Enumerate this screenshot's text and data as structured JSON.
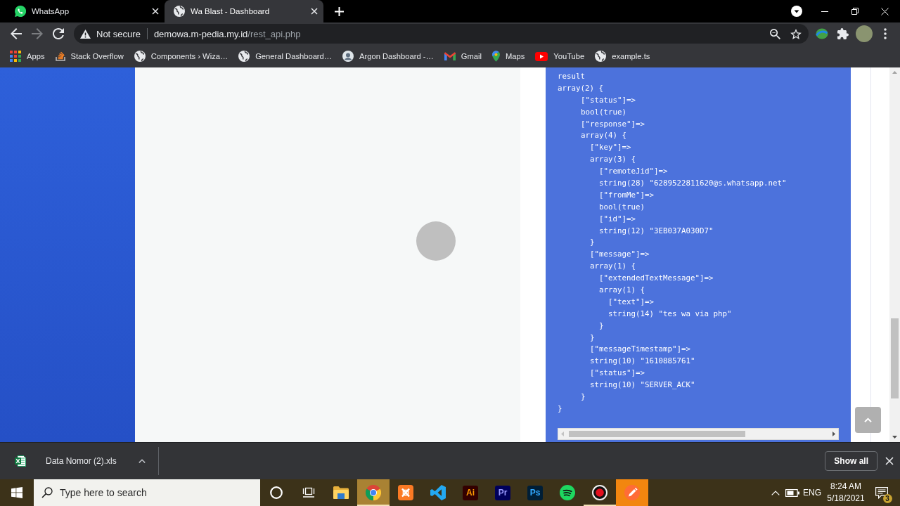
{
  "browser": {
    "tabs": [
      {
        "title": "WhatsApp",
        "kind": "chat",
        "selected": false
      },
      {
        "title": "Wa Blast - Dashboard",
        "kind": "globe",
        "selected": true
      }
    ],
    "toolbar": {
      "buttons": [
        {
          "kind": "back",
          "disabled": false
        },
        {
          "kind": "forward",
          "disabled": true
        },
        {
          "kind": "reload",
          "disabled": false
        }
      ],
      "security": "Not secure",
      "url": {
        "host": "demowa.m-pedia.my.id",
        "path": "/rest_api.php"
      }
    },
    "bookmarks": [
      {
        "label": "Apps",
        "kind": "apps"
      },
      {
        "label": "Stack Overflow",
        "kind": "stack"
      },
      {
        "label": "Components › Wiza…",
        "kind": "globe"
      },
      {
        "label": "General Dashboard…",
        "kind": "globe"
      },
      {
        "label": "Argon Dashboard -…",
        "kind": "avatar"
      },
      {
        "label": "Gmail",
        "kind": "mail"
      },
      {
        "label": "Maps",
        "kind": "pin"
      },
      {
        "label": "YouTube",
        "kind": "video"
      },
      {
        "label": "example.ts",
        "kind": "globe"
      }
    ]
  },
  "page": {
    "code": {
      "lines": [
        {
          "text": "result"
        },
        {
          "text": "array(2) {",
          "close": "}",
          "children": [
            {
              "text": "[\"status\"]=>"
            },
            {
              "text": "bool(true)"
            },
            {
              "text": "[\"response\"]=>"
            },
            {
              "text": "array(4) {",
              "close": "}",
              "children": [
                {
                  "text": "[\"key\"]=>"
                },
                {
                  "text": "array(3) {",
                  "close": "}",
                  "children": [
                    {
                      "text": "[\"remoteJid\"]=>"
                    },
                    {
                      "text": "string(28) \"6289522811620@s.whatsapp.net\""
                    },
                    {
                      "text": "[\"fromMe\"]=>"
                    },
                    {
                      "text": "bool(true)"
                    },
                    {
                      "text": "[\"id\"]=>"
                    },
                    {
                      "text": "string(12) \"3EB037A030D7\""
                    }
                  ]
                },
                {
                  "text": "[\"message\"]=>"
                },
                {
                  "text": "array(1) {",
                  "close": "}",
                  "children": [
                    {
                      "text": "[\"extendedTextMessage\"]=>"
                    },
                    {
                      "text": "array(1) {",
                      "close": "}",
                      "children": [
                        {
                          "text": "[\"text\"]=>"
                        },
                        {
                          "text": "string(14) \"tes wa via php\""
                        }
                      ]
                    }
                  ]
                },
                {
                  "text": "[\"messageTimestamp\"]=>"
                },
                {
                  "text": "string(10) \"1610885761\""
                },
                {
                  "text": "[\"status\"]=>"
                },
                {
                  "text": "string(10) \"SERVER_ACK\""
                }
              ]
            }
          ]
        }
      ]
    }
  },
  "downloads": {
    "items": [
      {
        "name": "Data Nomor (2).xls"
      }
    ],
    "show_all": "Show all"
  },
  "taskbar": {
    "search": {
      "placeholder": "Type here to search"
    },
    "buttons": [
      {
        "kind": "cortana",
        "selected": false,
        "running": false,
        "flashing": false
      },
      {
        "kind": "taskview",
        "selected": false,
        "running": false,
        "flashing": false
      },
      {
        "kind": "explorer",
        "selected": false,
        "running": false,
        "flashing": false
      },
      {
        "kind": "chrome",
        "selected": true,
        "running": true,
        "flashing": false
      },
      {
        "kind": "xampp",
        "selected": false,
        "running": false,
        "flashing": false
      },
      {
        "kind": "vscode",
        "selected": false,
        "running": false,
        "flashing": false
      },
      {
        "kind": "illustrator",
        "label": "Ai",
        "selected": false,
        "running": false,
        "flashing": false
      },
      {
        "kind": "premiere",
        "label": "Pr",
        "selected": false,
        "running": false,
        "flashing": false
      },
      {
        "kind": "photoshop",
        "label": "Ps",
        "selected": false,
        "running": false,
        "flashing": false
      },
      {
        "kind": "spotify",
        "selected": false,
        "running": false,
        "flashing": false
      },
      {
        "kind": "recorder",
        "selected": false,
        "running": true,
        "flashing": false
      },
      {
        "kind": "postman",
        "selected": false,
        "running": false,
        "flashing": true
      }
    ],
    "tray": {
      "language": "ENG",
      "time": "8:24 AM",
      "date": "5/18/2021",
      "notifications": "3"
    }
  }
}
